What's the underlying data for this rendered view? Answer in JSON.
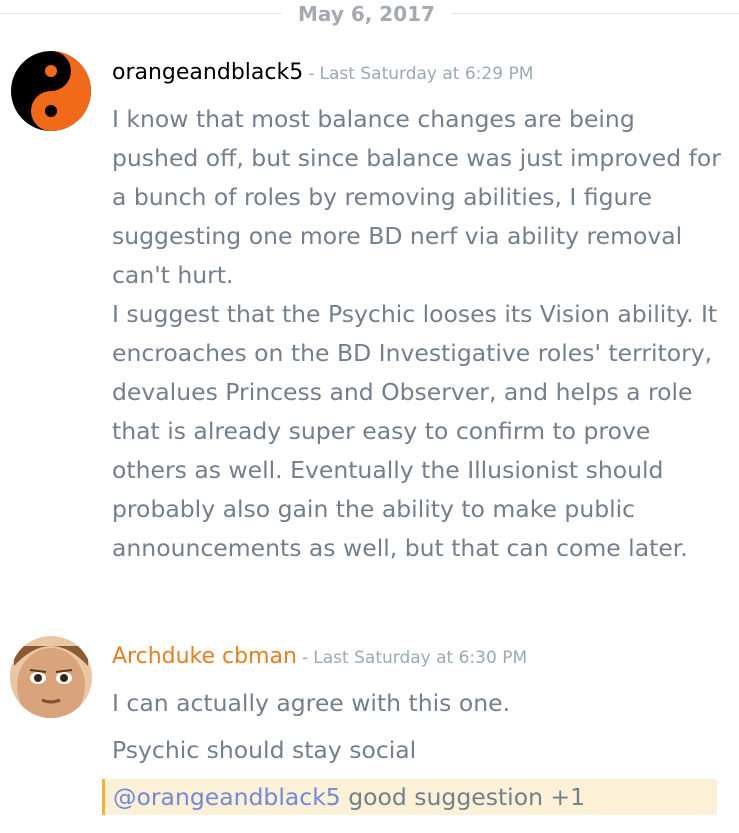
{
  "date_divider": "May 6, 2017",
  "messages": [
    {
      "username": "orangeandblack5",
      "username_color": "#000000",
      "separator": "-",
      "timestamp": "Last Saturday at 6:29 PM",
      "avatar_icon": "yin-yang-orange-black",
      "paragraphs": [
        "I know that most balance changes are being pushed off, but since balance was just improved for a bunch of roles by removing abilities, I figure suggesting one more BD nerf via ability removal can't hurt.",
        "I suggest that the Psychic looses its Vision ability. It encroaches on the BD Investigative roles' territory, devalues Princess and Observer, and helps a role that is already super easy to confirm to prove others as well. Eventually the Illusionist should probably also gain the ability to make public announcements as well, but that can come later."
      ]
    },
    {
      "username": "Archduke cbman",
      "username_color": "#e67e22",
      "separator": "-",
      "timestamp": "Last Saturday at 6:30 PM",
      "avatar_icon": "cartoon-face",
      "paragraphs": [
        "I can actually agree with this one.",
        "Psychic should stay social"
      ],
      "mention_line": {
        "mention": "@orangeandblack5",
        "text": " good suggestion +1"
      }
    }
  ],
  "colors": {
    "text": "#737f8d",
    "timestamp": "#99aab5",
    "mention": "#7289da",
    "mention_bg": "#fcf1d6",
    "mention_border": "#f2b23e"
  }
}
